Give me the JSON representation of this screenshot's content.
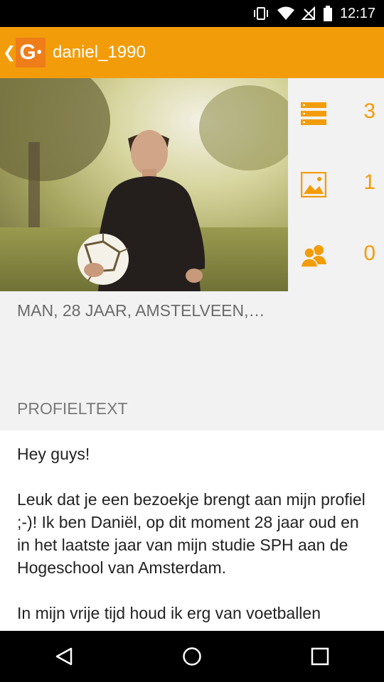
{
  "status_bar": {
    "time": "12:17"
  },
  "app_bar": {
    "logo_text": "G",
    "title": "daniel_1990"
  },
  "stats": [
    {
      "icon": "list-icon",
      "count": "3"
    },
    {
      "icon": "image-icon",
      "count": "1"
    },
    {
      "icon": "people-icon",
      "count": "0"
    }
  ],
  "profile": {
    "meta": "MAN, 28 JAAR, AMSTELVEEN,…",
    "section_label": "PROFIELTEXT",
    "text": {
      "greeting": "Hey guys!",
      "paragraph_1": "Leuk dat je een bezoekje brengt aan mijn profiel ;-)! Ik ben Daniël, op dit moment 28 jaar oud en in het laatste jaar van mijn studie SPH aan de Hogeschool van Amsterdam.",
      "paragraph_2": "In mijn vrije tijd houd ik erg van voetballen"
    }
  },
  "colors": {
    "accent": "#f39c0a",
    "logo_bg": "#ee7d1a"
  }
}
